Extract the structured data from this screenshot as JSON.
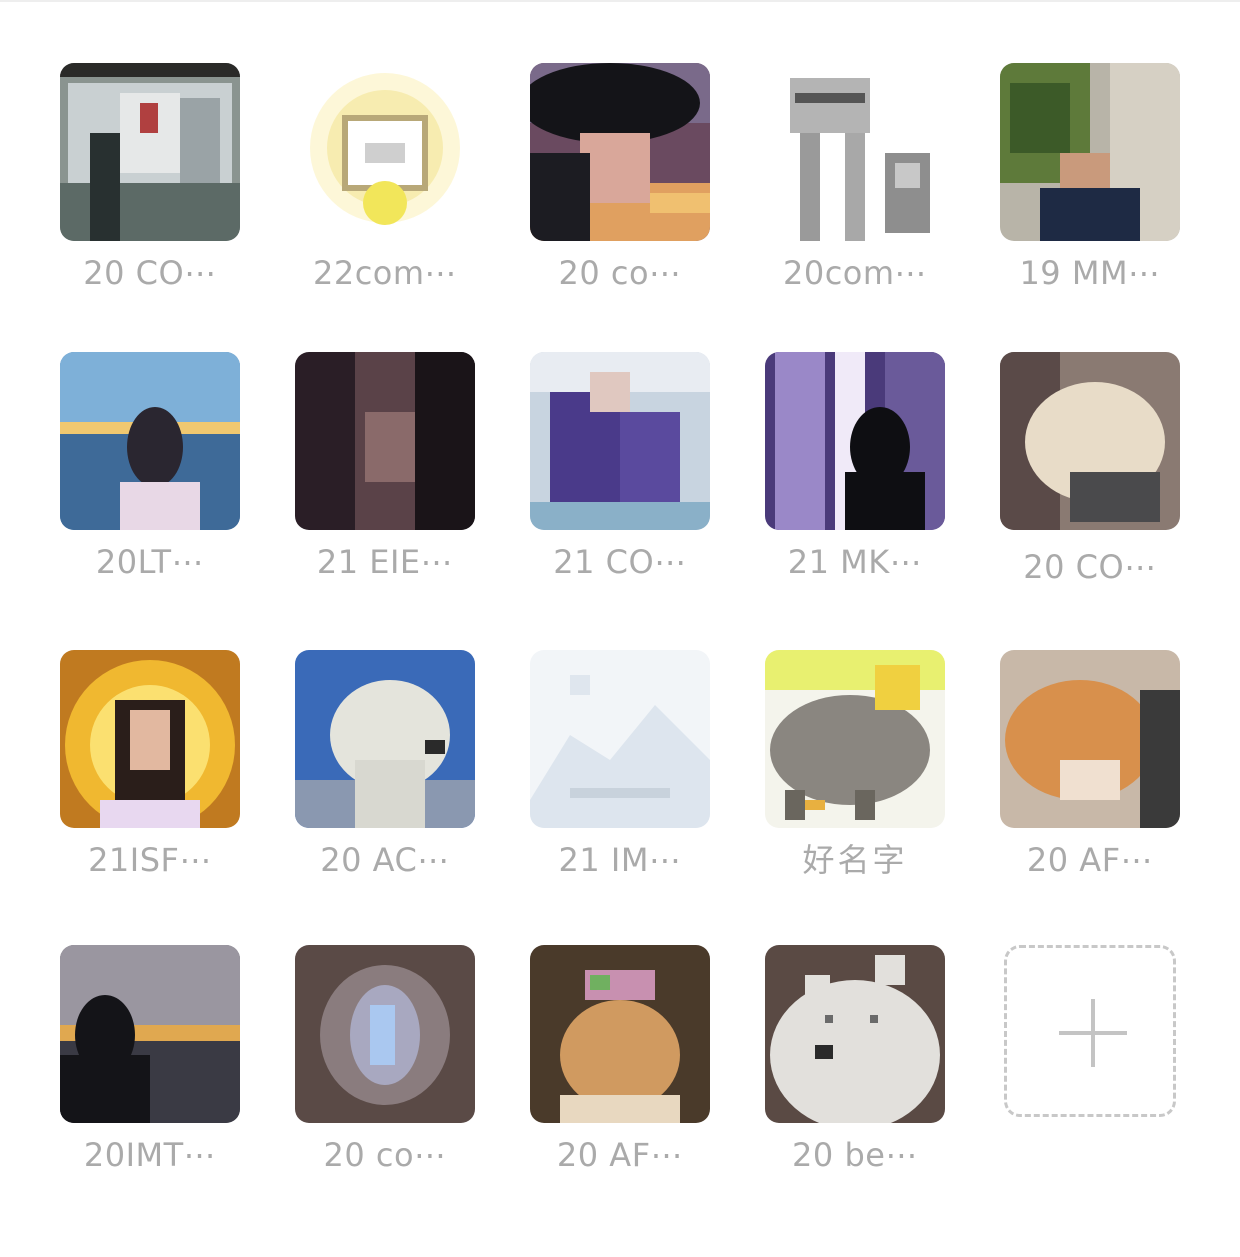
{
  "members": [
    {
      "name": "20 CO⋯",
      "avatar": "avatar-city-window"
    },
    {
      "name": "22com⋯",
      "avatar": "avatar-yellow-badge"
    },
    {
      "name": "20 co⋯",
      "avatar": "avatar-dark-hat-person"
    },
    {
      "name": "20com⋯",
      "avatar": "avatar-gray-cat-sketch"
    },
    {
      "name": "19 MM⋯",
      "avatar": "avatar-man-suit-plant"
    },
    {
      "name": "20LT⋯",
      "avatar": "avatar-girl-by-sea"
    },
    {
      "name": "21 EIE⋯",
      "avatar": "avatar-dark-portrait"
    },
    {
      "name": "21 CO⋯",
      "avatar": "avatar-anime-purple"
    },
    {
      "name": "21 MK⋯",
      "avatar": "avatar-silhouette-purple-light"
    },
    {
      "name": "20 CO⋯",
      "avatar": "avatar-fluffy-dog"
    },
    {
      "name": "21ISF⋯",
      "avatar": "avatar-girl-golden-halo"
    },
    {
      "name": "20 AC⋯",
      "avatar": "avatar-polar-bear-sky"
    },
    {
      "name": "21 IM⋯",
      "avatar": "avatar-default-placeholder"
    },
    {
      "name": "好名字",
      "avatar": "avatar-cartoon-creature"
    },
    {
      "name": "20 AF⋯",
      "avatar": "avatar-orange-cat"
    },
    {
      "name": "20IMT⋯",
      "avatar": "avatar-sunset-silhouette"
    },
    {
      "name": "20 co⋯",
      "avatar": "avatar-blurry-light"
    },
    {
      "name": "20 AF⋯",
      "avatar": "avatar-hamster-flowers"
    },
    {
      "name": "20 be⋯",
      "avatar": "avatar-white-bear-cartoon"
    }
  ],
  "add_button": {
    "icon": "plus-icon"
  }
}
